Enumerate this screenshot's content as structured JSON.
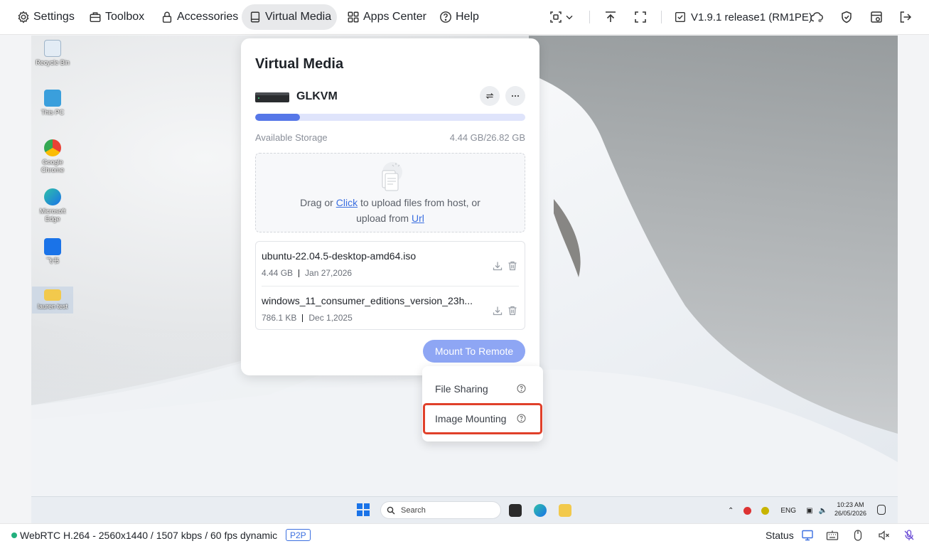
{
  "toolbar": {
    "nav": [
      {
        "label": "Settings",
        "icon": "gear-icon"
      },
      {
        "label": "Toolbox",
        "icon": "toolbox-icon"
      },
      {
        "label": "Accessories",
        "icon": "lock-icon"
      },
      {
        "label": "Virtual Media",
        "icon": "drive-icon",
        "active": true
      },
      {
        "label": "Apps Center",
        "icon": "grid-icon"
      },
      {
        "label": "Help",
        "icon": "help-icon"
      }
    ],
    "version": "V1.9.1 release1 (RM1PE)",
    "right_icons": [
      "screen-select-icon",
      "chevron-down-icon",
      "upload-top-icon",
      "fullscreen-icon",
      "version-check-icon",
      "cloud-icon",
      "shield-icon",
      "calendar-sync-icon",
      "logout-icon"
    ]
  },
  "desktop": {
    "icons": [
      {
        "label": "Recycle Bin"
      },
      {
        "label": "This PC"
      },
      {
        "label": "Google Chrome"
      },
      {
        "label": "Microsoft Edge"
      },
      {
        "label": "飞书"
      },
      {
        "label": "lauren test"
      }
    ],
    "taskbar": {
      "search_placeholder": "Search",
      "lang": "ENG",
      "time": "10:23 AM",
      "date": "26/05/2026"
    }
  },
  "virtual_media": {
    "title": "Virtual Media",
    "device_name": "GLKVM",
    "storage_label": "Available Storage",
    "storage_value": "4.44 GB/26.82 GB",
    "storage_used_fraction": 0.166,
    "drop_prefix": "Drag or ",
    "drop_click": "Click",
    "drop_middle": " to upload files from host, or",
    "drop_upload_from": "upload from ",
    "drop_url": "Url",
    "files": [
      {
        "name": "ubuntu-22.04.5-desktop-amd64.iso",
        "size": "4.44 GB",
        "date": "Jan 27,2026"
      },
      {
        "name": "windows_11_consumer_editions_version_23h...",
        "size": "786.1 KB",
        "date": "Dec 1,2025"
      }
    ],
    "mount_button": "Mount To Remote",
    "dropdown": [
      {
        "label": "File Sharing",
        "highlighted": false
      },
      {
        "label": "Image Mounting",
        "highlighted": true
      }
    ]
  },
  "statusbar": {
    "stream": "WebRTC H.264 - 2560x1440 / 1507 kbps / 60 fps dynamic",
    "badge": "P2P",
    "status_label": "Status",
    "icons": [
      "monitor-icon",
      "keyboard-icon",
      "mouse-icon",
      "speaker-muted-icon",
      "microphone-muted-icon"
    ]
  },
  "colors": {
    "accent": "#3b6fe0",
    "progress_fill": "#5677e8",
    "mount_button": "#8ea6f4",
    "highlight_outline": "#e0402a",
    "status_dot": "#22b07d"
  }
}
